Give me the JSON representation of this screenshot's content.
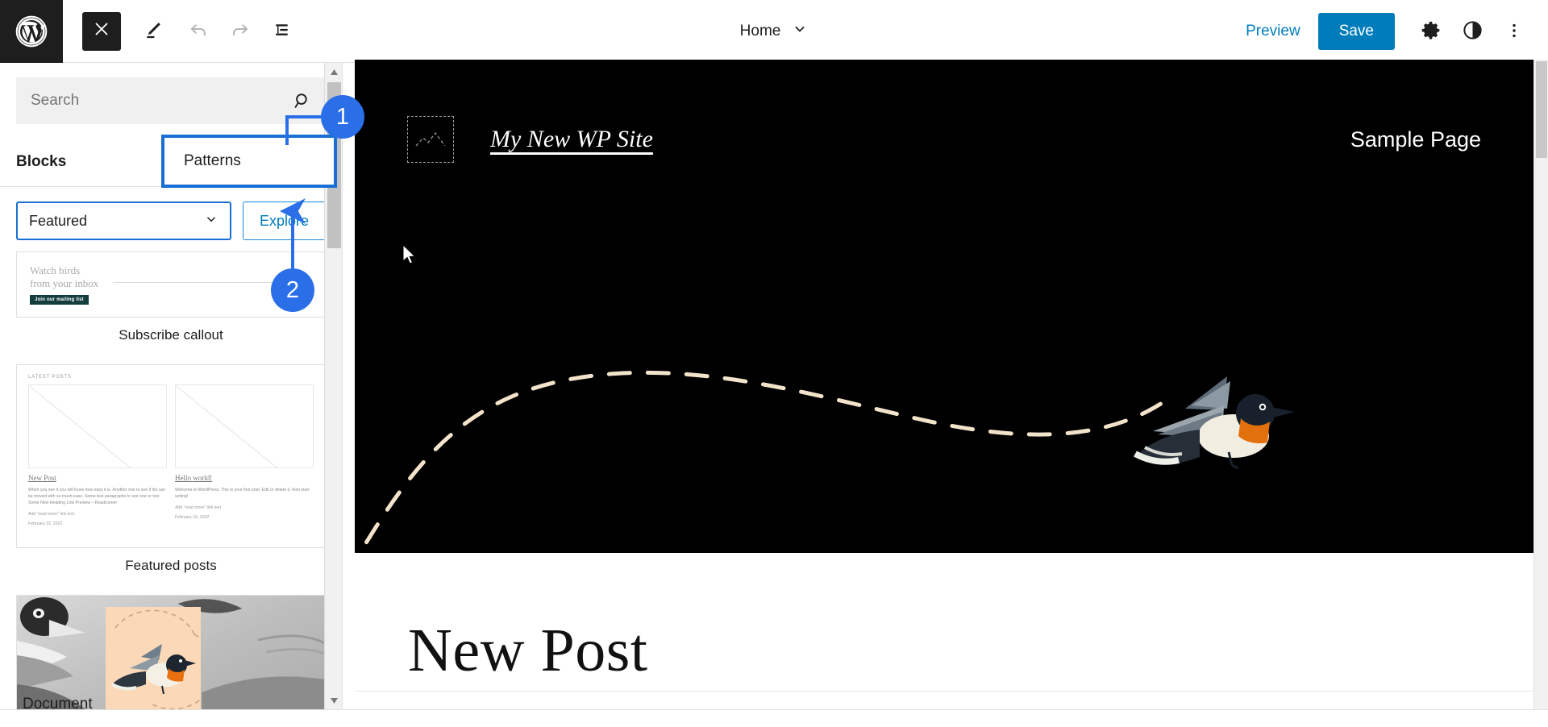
{
  "topbar": {
    "wp_logo_icon": "wordpress-logo-icon",
    "close_label": "Close",
    "close_icon": "close-x-icon",
    "edit_icon": "pencil-edit-icon",
    "undo_icon": "undo-arrow-icon",
    "redo_icon": "redo-arrow-icon",
    "listview_icon": "list-view-icon",
    "document_title": "Home",
    "chevron_icon": "chevron-down-icon",
    "preview_label": "Preview",
    "save_label": "Save",
    "settings_icon": "gear-icon",
    "styles_icon": "contrast-half-circle-icon",
    "more_icon": "three-dots-vertical-icon"
  },
  "sidebar": {
    "search": {
      "placeholder": "Search",
      "value": "",
      "icon": "search-magnifier-icon"
    },
    "tabs": [
      {
        "label": "Blocks",
        "active": false
      },
      {
        "label": "Patterns",
        "active": true
      }
    ],
    "category_select": {
      "value": "Featured",
      "icon": "chevron-down-icon"
    },
    "explore_label": "Explore",
    "patterns": [
      {
        "label": "Subscribe callout",
        "preview": {
          "heading_line1": "Watch birds",
          "heading_line2": "from your inbox",
          "button": "Join our mailing list"
        }
      },
      {
        "label": "Featured posts",
        "preview": {
          "section_title": "LATEST POSTS",
          "posts": [
            {
              "title": "New Post",
              "excerpt": "When you see it you will know how easy it is. Another one to see if list can be moved with so much ease. Some test paragraphs to see one or two Some New Heading Link Preview – Roadrunner",
              "read_more": "Add \"read more\" link text",
              "date": "February 22, 2022"
            },
            {
              "title": "Hello world!",
              "excerpt": "Welcome to WordPress. This is your first post. Edit or delete it, then start writing!",
              "read_more": "Add \"read more\" link text",
              "date": "February 16, 2022"
            }
          ]
        }
      },
      {
        "label": "",
        "preview": {
          "kind": "duck-and-bird-image"
        }
      }
    ],
    "scrollbar": {
      "up_icon": "scroll-up-arrow-icon",
      "down_icon": "scroll-down-arrow-icon"
    }
  },
  "canvas": {
    "site_logo_icon": "image-placeholder-icon",
    "site_title": "My New WP Site",
    "nav": [
      {
        "label": "Sample Page"
      }
    ],
    "post_title": "New Post",
    "flight_path": "dashed-curve-decoration",
    "bird_image": "flying-bird-illustration"
  },
  "footer": {
    "label": "Document"
  },
  "annotations": [
    {
      "id": "1",
      "label": "1",
      "target": "patterns-tab"
    },
    {
      "id": "2",
      "label": "2",
      "target": "explore-button"
    }
  ],
  "colors": {
    "accent": "#007cba",
    "annotation_blue": "#2b6fe8",
    "highlight_border": "#1a6fd4",
    "dark": "#1e1e1e"
  }
}
